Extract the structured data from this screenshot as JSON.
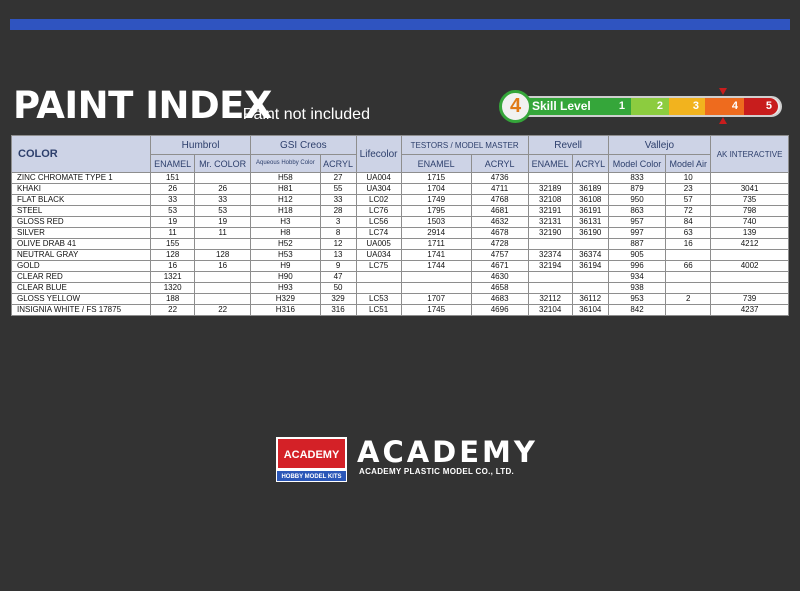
{
  "header": {
    "title": "PAINT INDEX",
    "subtitle": "- Paint not included"
  },
  "skill_level": {
    "label": "Skill Level",
    "value": "4",
    "levels": [
      "1",
      "2",
      "3",
      "4",
      "5"
    ],
    "colors": [
      "#35a63a",
      "#8ccc3f",
      "#f2b31e",
      "#ee6b1e",
      "#c81d1d"
    ]
  },
  "table": {
    "color_header": "COLOR",
    "brands": {
      "humbrol": "Humbrol",
      "gsi": "GSI Creos",
      "lifecolor": "Lifecolor",
      "testors": "TESTORS / MODEL MASTER",
      "revell": "Revell",
      "vallejo": "Vallejo",
      "ak": "AK INTERACTIVE"
    },
    "subheaders": {
      "humbrol_enamel": "ENAMEL",
      "humbrol_mrcolor": "Mr. COLOR",
      "gsi_aqueous": "Aqueous Hobby Color",
      "gsi_acryl": "ACRYL",
      "testors_enamel": "ENAMEL",
      "testors_acryl": "ACRYL",
      "revell_enamel": "ENAMEL",
      "revell_acryl": "ACRYL",
      "vallejo_model_color": "Model Color",
      "vallejo_model_air": "Model Air"
    },
    "rows": [
      [
        "ZINC CHROMATE TYPE 1",
        "151",
        "",
        "H58",
        "27",
        "UA004",
        "1715",
        "4736",
        "",
        "",
        "833",
        "10",
        ""
      ],
      [
        "KHAKI",
        "26",
        "26",
        "H81",
        "55",
        "UA304",
        "1704",
        "4711",
        "32189",
        "36189",
        "879",
        "23",
        "3041"
      ],
      [
        "FLAT BLACK",
        "33",
        "33",
        "H12",
        "33",
        "LC02",
        "1749",
        "4768",
        "32108",
        "36108",
        "950",
        "57",
        "735"
      ],
      [
        "STEEL",
        "53",
        "53",
        "H18",
        "28",
        "LC76",
        "1795",
        "4681",
        "32191",
        "36191",
        "863",
        "72",
        "798"
      ],
      [
        "GLOSS RED",
        "19",
        "19",
        "H3",
        "3",
        "LC56",
        "1503",
        "4632",
        "32131",
        "36131",
        "957",
        "84",
        "740"
      ],
      [
        "SILVER",
        "11",
        "11",
        "H8",
        "8",
        "LC74",
        "2914",
        "4678",
        "32190",
        "36190",
        "997",
        "63",
        "139"
      ],
      [
        "OLIVE DRAB 41",
        "155",
        "",
        "H52",
        "12",
        "UA005",
        "1711",
        "4728",
        "",
        "",
        "887",
        "16",
        "4212"
      ],
      [
        "NEUTRAL GRAY",
        "128",
        "128",
        "H53",
        "13",
        "UA034",
        "1741",
        "4757",
        "32374",
        "36374",
        "905",
        "",
        ""
      ],
      [
        "GOLD",
        "16",
        "16",
        "H9",
        "9",
        "LC75",
        "1744",
        "4671",
        "32194",
        "36194",
        "996",
        "66",
        "4002"
      ],
      [
        "CLEAR RED",
        "1321",
        "",
        "H90",
        "47",
        "",
        "",
        "4630",
        "",
        "",
        "934",
        "",
        ""
      ],
      [
        "CLEAR BLUE",
        "1320",
        "",
        "H93",
        "50",
        "",
        "",
        "4658",
        "",
        "",
        "938",
        "",
        ""
      ],
      [
        "GLOSS YELLOW",
        "188",
        "",
        "H329",
        "329",
        "LC53",
        "1707",
        "4683",
        "32112",
        "36112",
        "953",
        "2",
        "739"
      ],
      [
        "INSIGNIA WHITE / FS 17875",
        "22",
        "22",
        "H316",
        "316",
        "LC51",
        "1745",
        "4696",
        "32104",
        "36104",
        "842",
        "",
        "4237"
      ]
    ]
  },
  "footer": {
    "logo_text": "ACADEMY",
    "logo_subtext": "HOBBY MODEL KITS",
    "wordmark": "ACADEMY",
    "company": "ACADEMY PLASTIC MODEL CO., LTD."
  },
  "colors": {
    "background": "#333333",
    "accent_bar": "#2f54c0",
    "header_fill": "#cdd3e6",
    "header_text": "#2d3f6c"
  }
}
